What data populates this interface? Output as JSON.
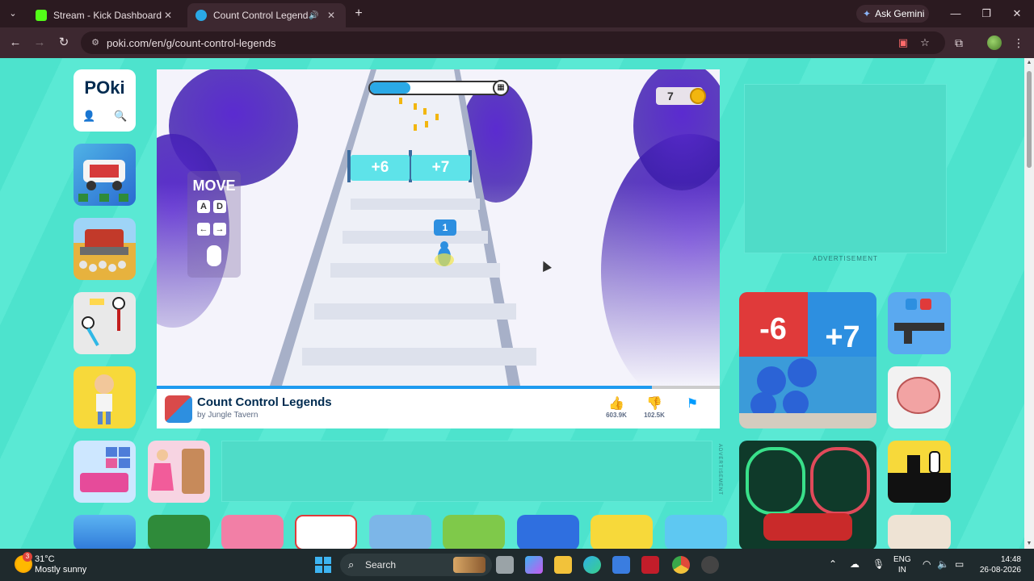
{
  "browser": {
    "tabs": [
      {
        "title": "Stream - Kick Dashboard",
        "favicon_color": "#53fc18"
      },
      {
        "title": "Count Control Legends - Pl",
        "favicon_color": "#2aa9e6",
        "active": true
      }
    ],
    "gemini_label": "Ask Gemini",
    "url": "poki.com/en/g/count-control-legends"
  },
  "poki": {
    "logo": "POki",
    "game": {
      "title": "Count Control Legends",
      "developer": "by Jungle Tavern",
      "likes": "603.9K",
      "dislikes": "102.5K",
      "coins": "7",
      "progress": 0.3,
      "gate_left": "+6",
      "gate_right": "+7",
      "crowd_count": "1",
      "move_label": "MOVE",
      "keys": [
        "A",
        "D",
        "←",
        "→"
      ]
    },
    "ad_label": "ADVERTISEMENT",
    "ad_label_vertical": "ADVERTISEMENT",
    "featured_tile": {
      "minus": "-6",
      "plus": "+7"
    }
  },
  "taskbar": {
    "weather": {
      "temp": "31°C",
      "desc": "Mostly sunny",
      "badge": "3"
    },
    "search_placeholder": "Search",
    "lang": {
      "l1": "ENG",
      "l2": "IN"
    },
    "clock": {
      "time": "14:48",
      "date": "26-08-2026"
    }
  }
}
